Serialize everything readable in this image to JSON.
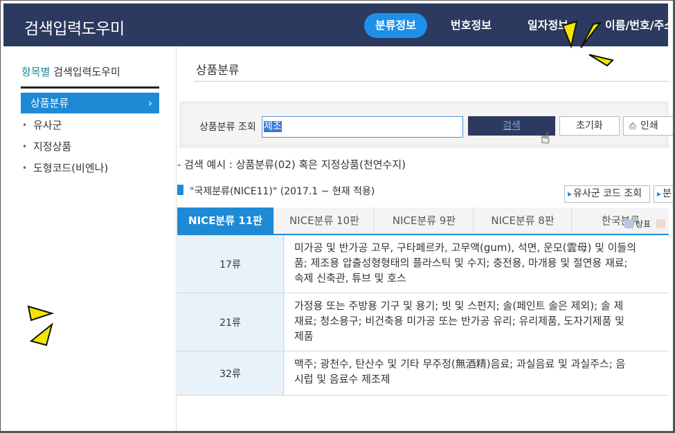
{
  "header": {
    "app_title": "검색입력도우미",
    "nav": [
      {
        "label": "분류정보",
        "active": true
      },
      {
        "label": "번호정보",
        "active": false
      },
      {
        "label": "일자정보",
        "active": false
      },
      {
        "label": "이름/번호/주소",
        "active": false
      }
    ]
  },
  "sidebar": {
    "heading_accent": "항목별",
    "heading_rest": " 검색입력도우미",
    "items": [
      {
        "label": "상품분류",
        "active": true
      },
      {
        "label": "유사군",
        "active": false
      },
      {
        "label": "지정상품",
        "active": false
      },
      {
        "label": "도형코드(비엔나)",
        "active": false
      }
    ],
    "active_chevron": "›"
  },
  "main": {
    "page_title": "상품분류",
    "search": {
      "label": "상품분류 조회",
      "value": "제조",
      "search_button": "검색",
      "reset_button": "초기화",
      "print_button": "인쇄"
    },
    "example_text": "- 검색 예시 : 상품분류(02) 혹은 지정상품(천연수지)",
    "nice_title": "\"국제분류(NICE11)\" (2017.1 ~ 현재 적용)",
    "code_button": "유사군 코드 조회",
    "more_button": "분",
    "tabs": [
      {
        "label": "NICE분류 11판",
        "active": true
      },
      {
        "label": "NICE분류 10판",
        "active": false
      },
      {
        "label": "NICE분류 9판",
        "active": false
      },
      {
        "label": "NICE분류 8판",
        "active": false
      },
      {
        "label": "한국분류",
        "active": false
      }
    ],
    "legend": {
      "label": "상표"
    },
    "rows": [
      {
        "class": "17류",
        "lines": [
          "미가공 및 반가공 고무, 구타페르카, 고무액(gum), 석면, 운모(雲母) 및 이들의",
          "품; 제조용 압출성형형태의 플라스틱 및 수지; 충전용, 마개용 및 절연용 재료;",
          "속제 신축관, 튜브 및 호스"
        ]
      },
      {
        "class": "21류",
        "lines": [
          "가정용 또는 주방용 기구 및 용기; 빗 및 스펀지; 솔(페인트 솔은 제외); 솔 제",
          "재료; 청소용구; 비건축용 미가공 또는 반가공 유리; 유리제품, 도자기제품 및",
          "제품"
        ]
      },
      {
        "class": "32류",
        "lines": [
          "맥주; 광천수, 탄산수 및 기타 무주정(無酒精)음료; 과실음료 및 과실주스; 음",
          "시럽 및 음료수 제조제"
        ]
      }
    ]
  },
  "colors": {
    "header_bg": "#2b3a5e",
    "accent_blue": "#1e8ad6",
    "row_bg": "#eaf2f9",
    "annotation_arrow": "#f2e600"
  }
}
